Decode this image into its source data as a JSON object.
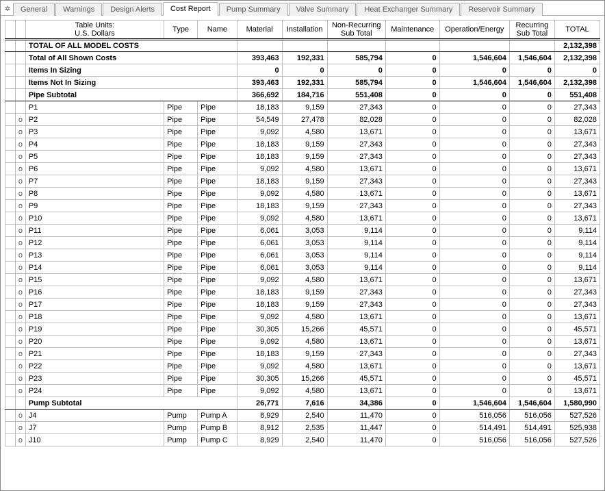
{
  "tabs": [
    "General",
    "Warnings",
    "Design Alerts",
    "Cost Report",
    "Pump Summary",
    "Valve Summary",
    "Heat Exchanger Summary",
    "Reservoir Summary"
  ],
  "activeTab": 3,
  "headers": {
    "units_l1": "Table Units:",
    "units_l2": "U.S. Dollars",
    "type": "Type",
    "name": "Name",
    "material": "Material",
    "installation": "Installation",
    "nonrec_l1": "Non-Recurring",
    "nonrec_l2": "Sub Total",
    "maintenance": "Maintenance",
    "opEnergy": "Operation/Energy",
    "rec_l1": "Recurring",
    "rec_l2": "Sub Total",
    "total": "TOTAL"
  },
  "summary": {
    "grandLabel": "TOTAL OF ALL MODEL COSTS",
    "grandTotal": "2,132,398",
    "shown": {
      "label": "Total of All Shown Costs",
      "material": "393,463",
      "install": "192,331",
      "nonrec": "585,794",
      "maint": "0",
      "op": "1,546,604",
      "rec": "1,546,604",
      "total": "2,132,398"
    },
    "inSizing": {
      "label": "Items In Sizing",
      "material": "0",
      "install": "0",
      "nonrec": "0",
      "maint": "0",
      "op": "0",
      "rec": "0",
      "total": "0"
    },
    "notInSizing": {
      "label": "Items Not In Sizing",
      "material": "393,463",
      "install": "192,331",
      "nonrec": "585,794",
      "maint": "0",
      "op": "1,546,604",
      "rec": "1,546,604",
      "total": "2,132,398"
    },
    "pipeSub": {
      "label": "Pipe Subtotal",
      "material": "366,692",
      "install": "184,716",
      "nonrec": "551,408",
      "maint": "0",
      "op": "0",
      "rec": "0",
      "total": "551,408"
    },
    "pumpSub": {
      "label": "Pump Subtotal",
      "material": "26,771",
      "install": "7,616",
      "nonrec": "34,386",
      "maint": "0",
      "op": "1,546,604",
      "rec": "1,546,604",
      "total": "1,580,990"
    }
  },
  "pipes": [
    {
      "m": "",
      "id": "P1",
      "type": "Pipe",
      "name": "Pipe",
      "material": "18,183",
      "install": "9,159",
      "nonrec": "27,343",
      "maint": "0",
      "op": "0",
      "rec": "0",
      "total": "27,343"
    },
    {
      "m": "o",
      "id": "P2",
      "type": "Pipe",
      "name": "Pipe",
      "material": "54,549",
      "install": "27,478",
      "nonrec": "82,028",
      "maint": "0",
      "op": "0",
      "rec": "0",
      "total": "82,028"
    },
    {
      "m": "o",
      "id": "P3",
      "type": "Pipe",
      "name": "Pipe",
      "material": "9,092",
      "install": "4,580",
      "nonrec": "13,671",
      "maint": "0",
      "op": "0",
      "rec": "0",
      "total": "13,671"
    },
    {
      "m": "o",
      "id": "P4",
      "type": "Pipe",
      "name": "Pipe",
      "material": "18,183",
      "install": "9,159",
      "nonrec": "27,343",
      "maint": "0",
      "op": "0",
      "rec": "0",
      "total": "27,343"
    },
    {
      "m": "o",
      "id": "P5",
      "type": "Pipe",
      "name": "Pipe",
      "material": "18,183",
      "install": "9,159",
      "nonrec": "27,343",
      "maint": "0",
      "op": "0",
      "rec": "0",
      "total": "27,343"
    },
    {
      "m": "o",
      "id": "P6",
      "type": "Pipe",
      "name": "Pipe",
      "material": "9,092",
      "install": "4,580",
      "nonrec": "13,671",
      "maint": "0",
      "op": "0",
      "rec": "0",
      "total": "13,671"
    },
    {
      "m": "o",
      "id": "P7",
      "type": "Pipe",
      "name": "Pipe",
      "material": "18,183",
      "install": "9,159",
      "nonrec": "27,343",
      "maint": "0",
      "op": "0",
      "rec": "0",
      "total": "27,343"
    },
    {
      "m": "o",
      "id": "P8",
      "type": "Pipe",
      "name": "Pipe",
      "material": "9,092",
      "install": "4,580",
      "nonrec": "13,671",
      "maint": "0",
      "op": "0",
      "rec": "0",
      "total": "13,671"
    },
    {
      "m": "o",
      "id": "P9",
      "type": "Pipe",
      "name": "Pipe",
      "material": "18,183",
      "install": "9,159",
      "nonrec": "27,343",
      "maint": "0",
      "op": "0",
      "rec": "0",
      "total": "27,343"
    },
    {
      "m": "o",
      "id": "P10",
      "type": "Pipe",
      "name": "Pipe",
      "material": "9,092",
      "install": "4,580",
      "nonrec": "13,671",
      "maint": "0",
      "op": "0",
      "rec": "0",
      "total": "13,671"
    },
    {
      "m": "o",
      "id": "P11",
      "type": "Pipe",
      "name": "Pipe",
      "material": "6,061",
      "install": "3,053",
      "nonrec": "9,114",
      "maint": "0",
      "op": "0",
      "rec": "0",
      "total": "9,114"
    },
    {
      "m": "o",
      "id": "P12",
      "type": "Pipe",
      "name": "Pipe",
      "material": "6,061",
      "install": "3,053",
      "nonrec": "9,114",
      "maint": "0",
      "op": "0",
      "rec": "0",
      "total": "9,114"
    },
    {
      "m": "o",
      "id": "P13",
      "type": "Pipe",
      "name": "Pipe",
      "material": "6,061",
      "install": "3,053",
      "nonrec": "9,114",
      "maint": "0",
      "op": "0",
      "rec": "0",
      "total": "9,114"
    },
    {
      "m": "o",
      "id": "P14",
      "type": "Pipe",
      "name": "Pipe",
      "material": "6,061",
      "install": "3,053",
      "nonrec": "9,114",
      "maint": "0",
      "op": "0",
      "rec": "0",
      "total": "9,114"
    },
    {
      "m": "o",
      "id": "P15",
      "type": "Pipe",
      "name": "Pipe",
      "material": "9,092",
      "install": "4,580",
      "nonrec": "13,671",
      "maint": "0",
      "op": "0",
      "rec": "0",
      "total": "13,671"
    },
    {
      "m": "o",
      "id": "P16",
      "type": "Pipe",
      "name": "Pipe",
      "material": "18,183",
      "install": "9,159",
      "nonrec": "27,343",
      "maint": "0",
      "op": "0",
      "rec": "0",
      "total": "27,343"
    },
    {
      "m": "o",
      "id": "P17",
      "type": "Pipe",
      "name": "Pipe",
      "material": "18,183",
      "install": "9,159",
      "nonrec": "27,343",
      "maint": "0",
      "op": "0",
      "rec": "0",
      "total": "27,343"
    },
    {
      "m": "o",
      "id": "P18",
      "type": "Pipe",
      "name": "Pipe",
      "material": "9,092",
      "install": "4,580",
      "nonrec": "13,671",
      "maint": "0",
      "op": "0",
      "rec": "0",
      "total": "13,671"
    },
    {
      "m": "o",
      "id": "P19",
      "type": "Pipe",
      "name": "Pipe",
      "material": "30,305",
      "install": "15,266",
      "nonrec": "45,571",
      "maint": "0",
      "op": "0",
      "rec": "0",
      "total": "45,571"
    },
    {
      "m": "o",
      "id": "P20",
      "type": "Pipe",
      "name": "Pipe",
      "material": "9,092",
      "install": "4,580",
      "nonrec": "13,671",
      "maint": "0",
      "op": "0",
      "rec": "0",
      "total": "13,671"
    },
    {
      "m": "o",
      "id": "P21",
      "type": "Pipe",
      "name": "Pipe",
      "material": "18,183",
      "install": "9,159",
      "nonrec": "27,343",
      "maint": "0",
      "op": "0",
      "rec": "0",
      "total": "27,343"
    },
    {
      "m": "o",
      "id": "P22",
      "type": "Pipe",
      "name": "Pipe",
      "material": "9,092",
      "install": "4,580",
      "nonrec": "13,671",
      "maint": "0",
      "op": "0",
      "rec": "0",
      "total": "13,671"
    },
    {
      "m": "o",
      "id": "P23",
      "type": "Pipe",
      "name": "Pipe",
      "material": "30,305",
      "install": "15,266",
      "nonrec": "45,571",
      "maint": "0",
      "op": "0",
      "rec": "0",
      "total": "45,571"
    },
    {
      "m": "o",
      "id": "P24",
      "type": "Pipe",
      "name": "Pipe",
      "material": "9,092",
      "install": "4,580",
      "nonrec": "13,671",
      "maint": "0",
      "op": "0",
      "rec": "0",
      "total": "13,671"
    }
  ],
  "pumps": [
    {
      "m": "o",
      "id": "J4",
      "type": "Pump",
      "name": "Pump A",
      "material": "8,929",
      "install": "2,540",
      "nonrec": "11,470",
      "maint": "0",
      "op": "516,056",
      "rec": "516,056",
      "total": "527,526"
    },
    {
      "m": "o",
      "id": "J7",
      "type": "Pump",
      "name": "Pump B",
      "material": "8,912",
      "install": "2,535",
      "nonrec": "11,447",
      "maint": "0",
      "op": "514,491",
      "rec": "514,491",
      "total": "525,938"
    },
    {
      "m": "o",
      "id": "J10",
      "type": "Pump",
      "name": "Pump C",
      "material": "8,929",
      "install": "2,540",
      "nonrec": "11,470",
      "maint": "0",
      "op": "516,056",
      "rec": "516,056",
      "total": "527,526"
    }
  ]
}
